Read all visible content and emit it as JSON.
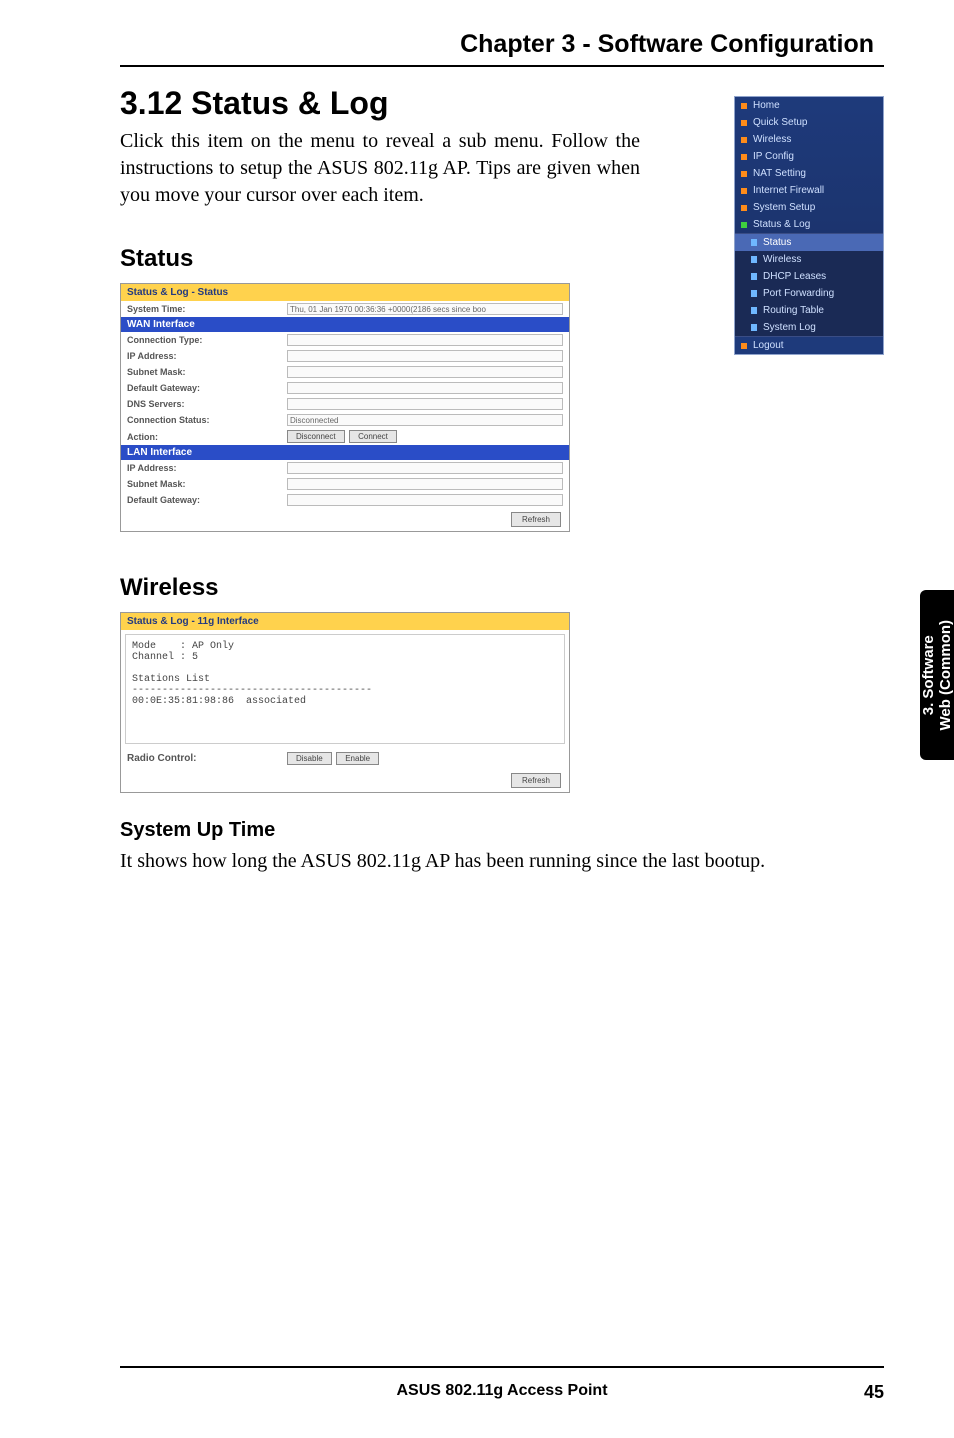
{
  "chapter_title": "Chapter 3 - Software Configuration",
  "section_title": "3.12  Status & Log",
  "intro_text": "Click this item on the menu to reveal a sub menu. Follow the instructions to setup the ASUS 802.11g AP. Tips are given when you move your cursor over each item.",
  "status_heading": "Status",
  "wireless_heading": "Wireless",
  "system_uptime_heading": "System Up Time",
  "system_uptime_text": "It shows how long the ASUS 802.11g AP has been running since the last bootup.",
  "sidebar": {
    "items": {
      "home": "Home",
      "quick_setup": "Quick Setup",
      "wireless": "Wireless",
      "ip_config": "IP Config",
      "nat_setting": "NAT Setting",
      "internet_firewall": "Internet Firewall",
      "system_setup": "System Setup",
      "status_log": "Status & Log",
      "logout": "Logout"
    },
    "subitems": {
      "status": "Status",
      "wireless": "Wireless",
      "dhcp_leases": "DHCP Leases",
      "port_forwarding": "Port Forwarding",
      "routing_table": "Routing Table",
      "system_log": "System Log"
    }
  },
  "status_panel": {
    "title": "Status & Log - Status",
    "system_time_label": "System Time:",
    "system_time_value": "Thu, 01 Jan 1970 00:36:36 +0000(2186 secs since boo",
    "wan_interface": "WAN Interface",
    "connection_type": "Connection Type:",
    "ip_address": "IP Address:",
    "subnet_mask": "Subnet Mask:",
    "default_gateway": "Default Gateway:",
    "dns_servers": "DNS Servers:",
    "connection_status_label": "Connection Status:",
    "connection_status_value": "Disconnected",
    "action_label": "Action:",
    "disconnect_btn": "Disconnect",
    "connect_btn": "Connect",
    "lan_interface": "LAN Interface",
    "refresh_btn": "Refresh"
  },
  "wireless_panel": {
    "title": "Status & Log - 11g Interface",
    "mode_line": "Mode    : AP Only",
    "channel_line": "Channel : 5",
    "stations_list_label": "Stations List",
    "dashes": "----------------------------------------",
    "station_entry": "00:0E:35:81:98:86  associated",
    "radio_control_label": "Radio Control:",
    "disable_btn": "Disable",
    "enable_btn": "Enable",
    "refresh_btn": "Refresh"
  },
  "side_tab": {
    "line1": "3. Software",
    "line2": "Web (Common)"
  },
  "footer": {
    "product": "ASUS 802.11g Access Point",
    "page": "45"
  }
}
